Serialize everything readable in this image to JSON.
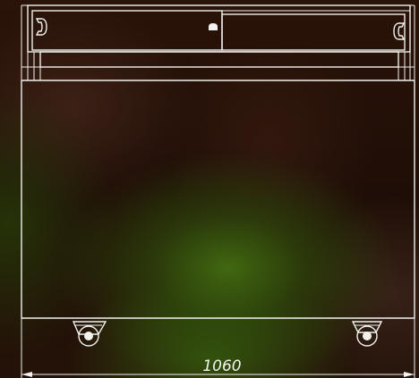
{
  "drawing": {
    "dimension_width": "1060"
  }
}
